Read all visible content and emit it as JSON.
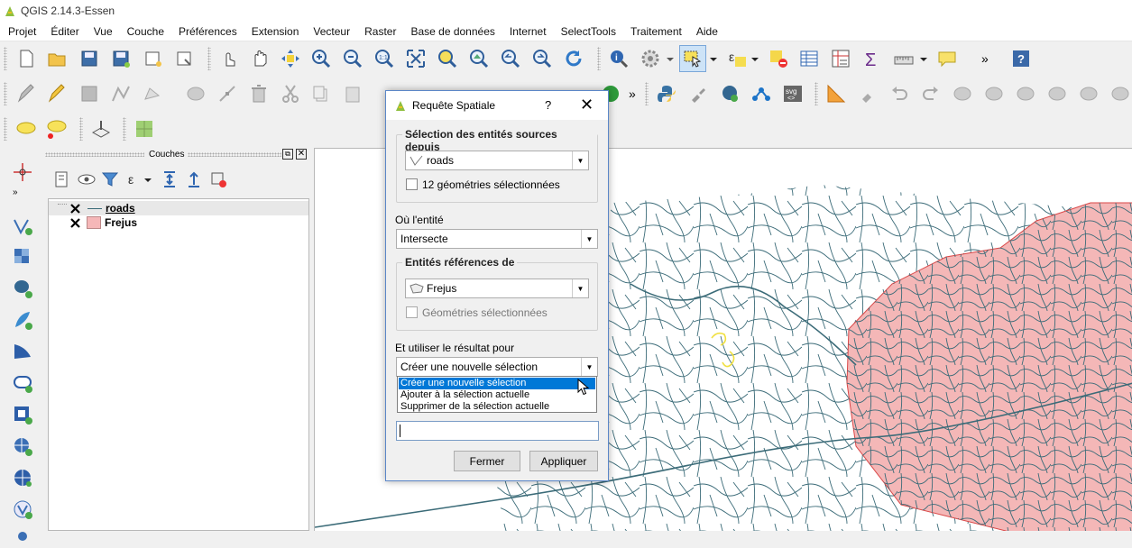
{
  "window": {
    "title": "QGIS 2.14.3-Essen"
  },
  "menu": [
    "Projet",
    "Éditer",
    "Vue",
    "Couche",
    "Préférences",
    "Extension",
    "Vecteur",
    "Raster",
    "Base de données",
    "Internet",
    "SelectTools",
    "Traitement",
    "Aide"
  ],
  "toolbar_overflow": "»",
  "layers_panel": {
    "title": "Couches",
    "layers": [
      {
        "name": "roads",
        "checked": true,
        "symbol": "line"
      },
      {
        "name": "Frejus",
        "checked": true,
        "symbol": "polygon",
        "color": "#f5b7b8"
      }
    ]
  },
  "dialog": {
    "title": "Requête Spatiale",
    "help": "?",
    "close": "✕",
    "source_group": "Sélection des entités sources depuis",
    "source_layer": "roads",
    "source_selected": "12 géométries sélectionnées",
    "where_label": "Où l'entité",
    "where_value": "Intersecte",
    "ref_group": "Entités références de",
    "ref_layer": "Frejus",
    "ref_selected": "Géométries sélectionnées",
    "use_label": "Et utiliser le résultat pour",
    "use_value": "Créer une nouvelle sélection",
    "use_options": [
      "Créer une nouvelle sélection",
      "Ajouter à la sélection actuelle",
      "Supprimer de la sélection actuelle"
    ],
    "close_button": "Fermer",
    "apply_button": "Appliquer"
  },
  "colors": {
    "road": "#3b6b78",
    "polygon_fill": "#f4b7b7",
    "polygon_stroke": "#d94848",
    "selection": "#f0e040",
    "accent": "#0078d7"
  }
}
